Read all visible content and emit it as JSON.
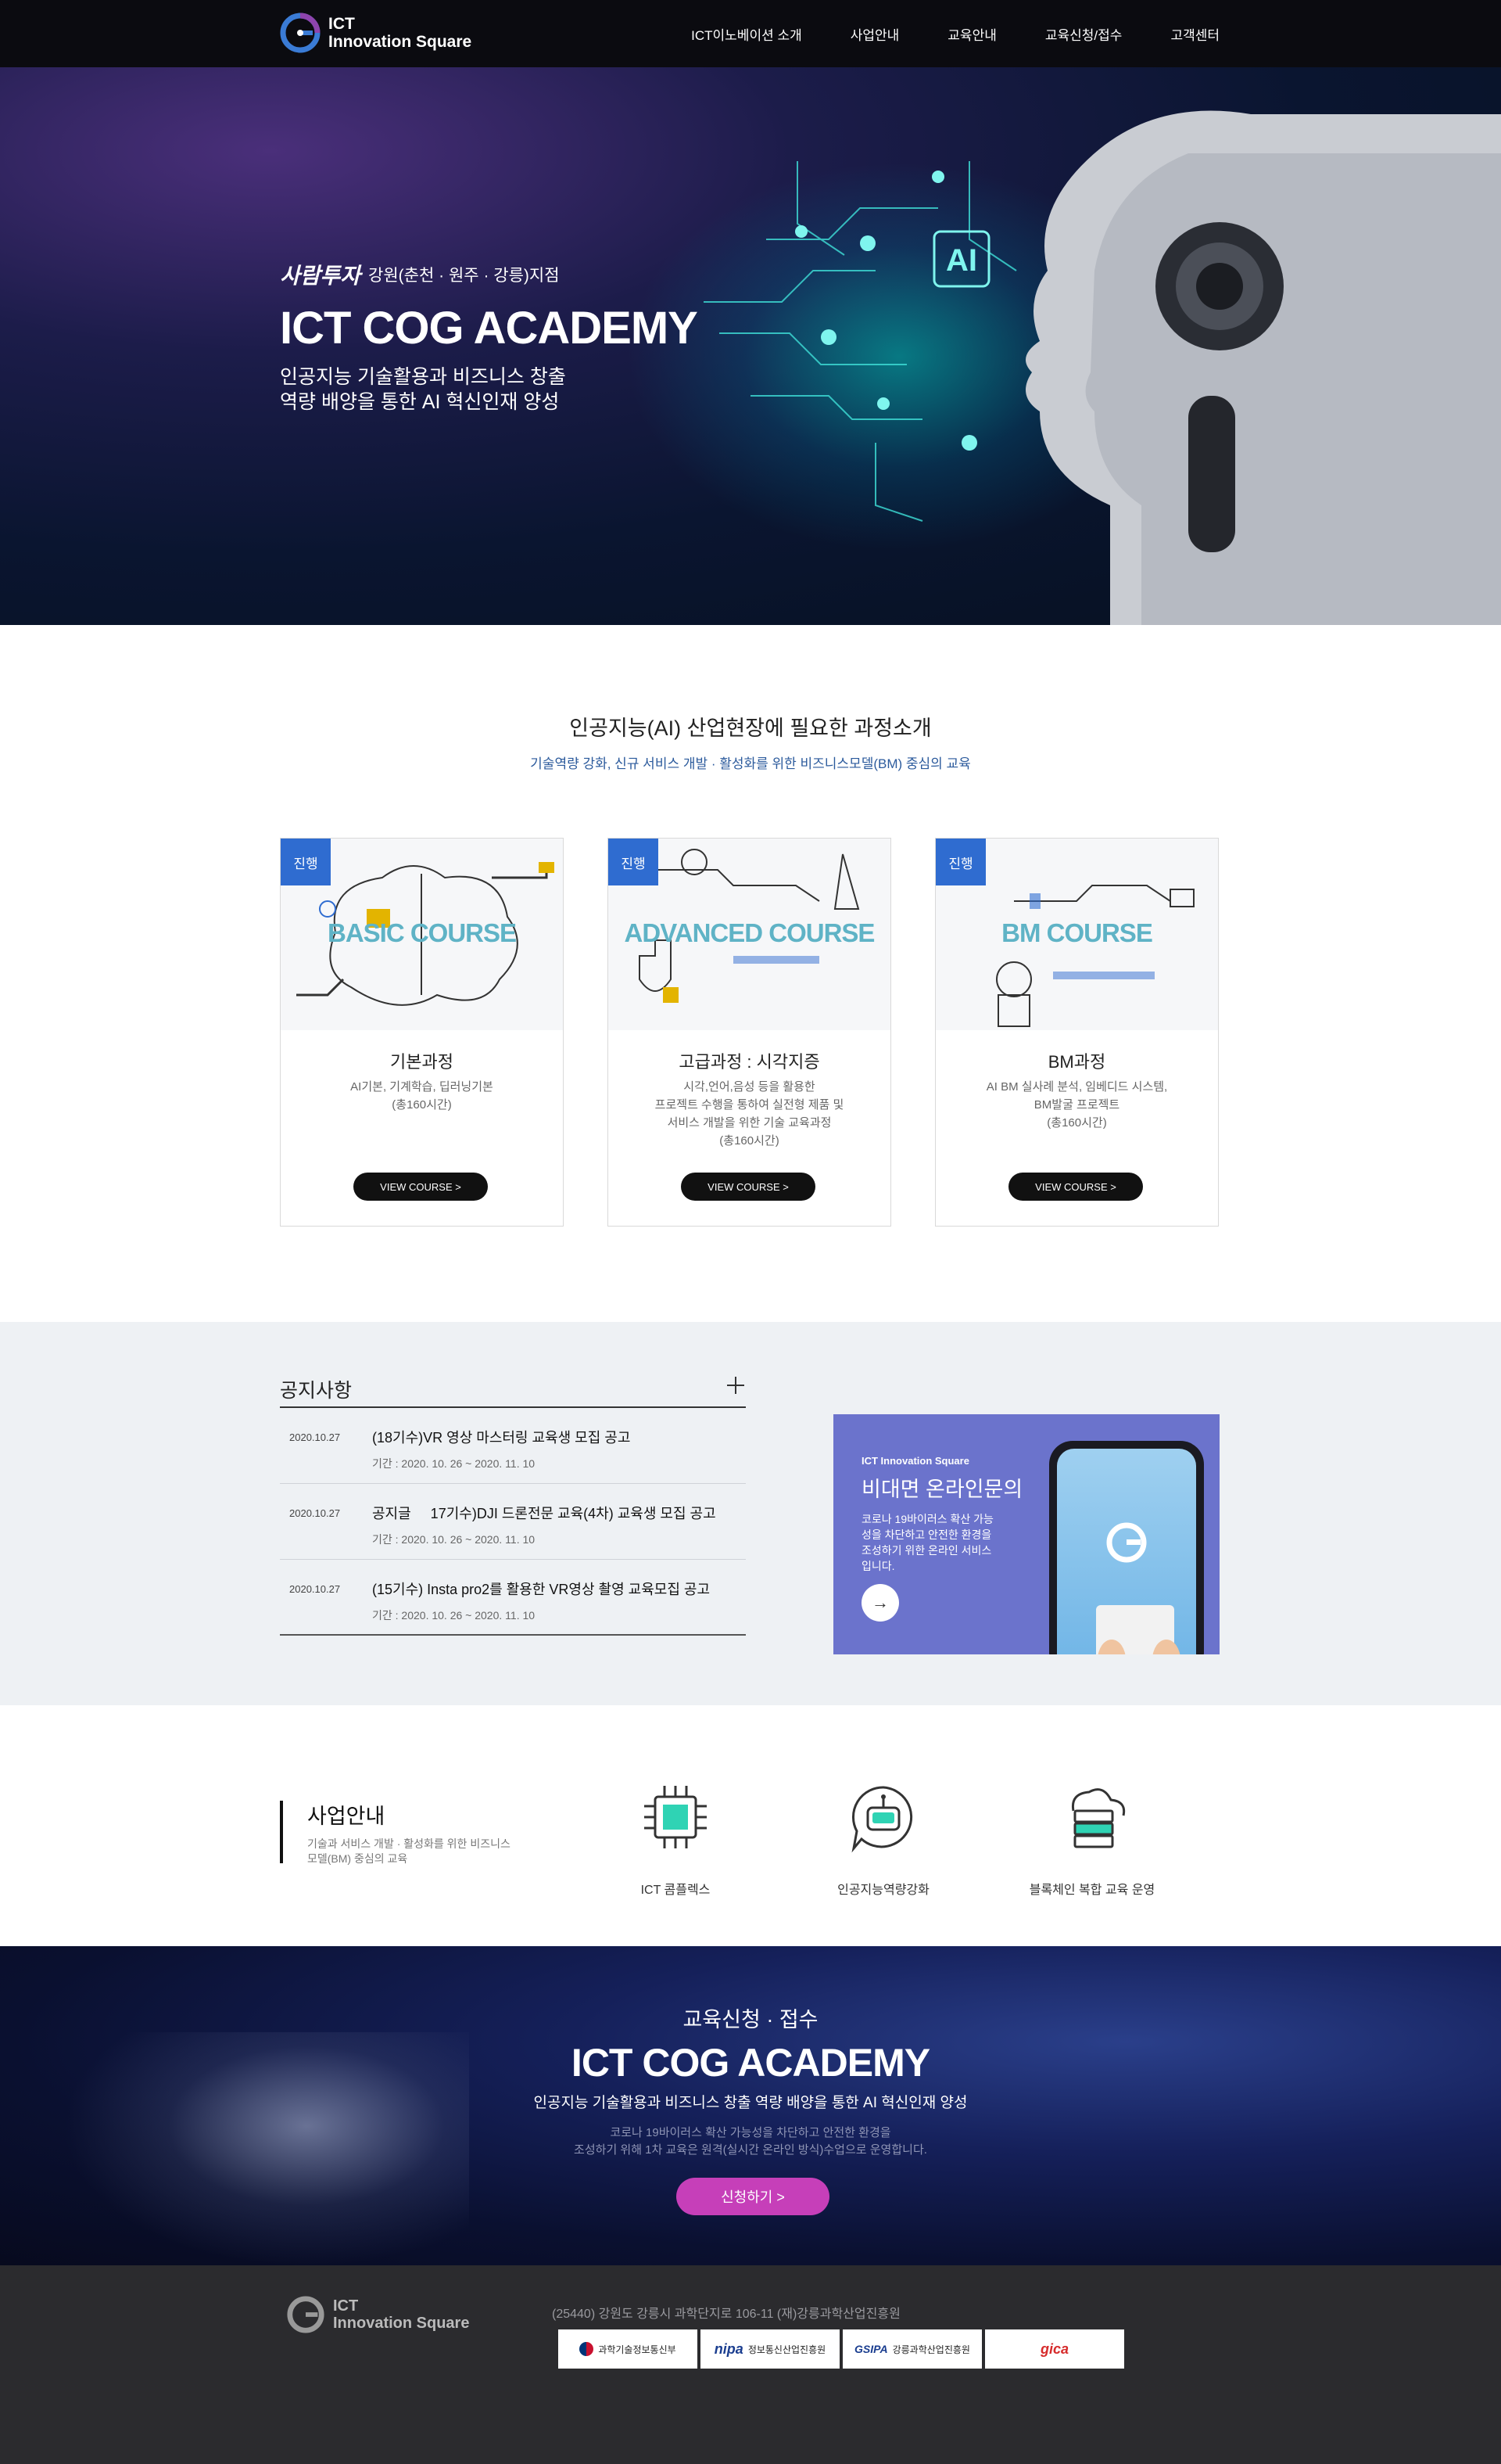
{
  "header": {
    "logo_line1": "ICT",
    "logo_line2": "Innovation Square",
    "nav": [
      "ICT이노베이션 소개",
      "사업안내",
      "교육안내",
      "교육신청/접수",
      "고객센터"
    ]
  },
  "hero": {
    "brand": "사람투자",
    "region": "강원(춘천 · 원주 · 강릉)지점",
    "title": "ICT COG ACADEMY",
    "desc_line1": "인공지능 기술활용과 비즈니스 창출",
    "desc_line2": "역량 배양을 통한 AI 혁신인재 양성",
    "art_label": "AI"
  },
  "courses": {
    "title": "인공지능(AI) 산업현장에 필요한 과정소개",
    "subtitle": "기술역량 강화, 신규 서비스 개발 · 활성화를 위한 비즈니스모델(BM) 중심의 교육",
    "items": [
      {
        "badge": "진행",
        "art": "BASIC COURSE",
        "name": "기본과정",
        "desc": "AI기본, 기계학습, 딥러닝기본\n(총160시간)",
        "button": "VIEW COURSE >"
      },
      {
        "badge": "진행",
        "art": "ADVANCED COURSE",
        "name": "고급과정 : 시각지증",
        "desc": "시각,언어,음성 등을 활용한\n프로젝트 수행을 통하여 실전형 제품 및\n서비스 개발을 위한 기술 교육과정\n(총160시간)",
        "button": "VIEW COURSE >"
      },
      {
        "badge": "진행",
        "art": "BM COURSE",
        "name": "BM과정",
        "desc": "AI BM 실사례 분석, 임베디드 시스템,\nBM발굴 프로젝트\n(총160시간)",
        "button": "VIEW COURSE >"
      }
    ]
  },
  "notice": {
    "title": "공지사항",
    "items": [
      {
        "date": "2020.10.27",
        "title": "(18기수)VR 영상 마스터링 교육생 모집 공고",
        "period": "기간 : 2020. 10. 26 ~ 2020. 11. 10"
      },
      {
        "date": "2020.10.27",
        "title": "공지글     17기수)DJI 드론전문 교육(4차) 교육생 모집 공고",
        "period": "기간 : 2020. 10. 26 ~ 2020. 11. 10"
      },
      {
        "date": "2020.10.27",
        "title": "(15기수) Insta pro2를 활용한 VR영상 촬영 교육모집 공고",
        "period": "기간 : 2020. 10. 26 ~ 2020. 11. 10"
      }
    ]
  },
  "online": {
    "small": "ICT Innovation Square",
    "title": "비대면 온라인문의",
    "desc": "코로나 19바이러스 확산 가능성을 차단하고 안전한 환경을 조성하기 위한 온라인 서비스 입니다.",
    "arrow": "→"
  },
  "business": {
    "title": "사업안내",
    "desc": "기술과 서비스 개발 · 활성화를 위한 비즈니스모델(BM) 중심의 교육",
    "items": [
      {
        "label": "ICT 콤플렉스",
        "icon": "chip-icon"
      },
      {
        "label": "인공지능역량강화",
        "icon": "robot-chat-icon"
      },
      {
        "label": "블록체인 복합 교육 운영",
        "icon": "cloud-server-icon"
      }
    ]
  },
  "apply": {
    "top": "교육신청 · 접수",
    "title": "ICT COG ACADEMY",
    "sub": "인공지능 기술활용과 비즈니스 창출 역량 배양을 통한 AI 혁신인재 양성",
    "note_line1": "코로나 19바이러스 확산 가능성을 차단하고 안전한 환경을",
    "note_line2": "조성하기 위해 1차 교육은 원격(실시간 온라인 방식)수업으로 운영합니다.",
    "button": "신청하기 >"
  },
  "footer": {
    "logo_line1": "ICT",
    "logo_line2": "Innovation Square",
    "address": "(25440) 강원도 강릉시 과학단지로 106-11 (재)강릉과학산업진흥원",
    "partners": [
      {
        "mark": "",
        "text": "과학기술정보통신부"
      },
      {
        "mark": "nipa",
        "text": "정보통신산업진흥원"
      },
      {
        "mark": "GSIPA",
        "text": "강릉과학산업진흥원"
      },
      {
        "mark": "gica",
        "text": ""
      }
    ]
  }
}
